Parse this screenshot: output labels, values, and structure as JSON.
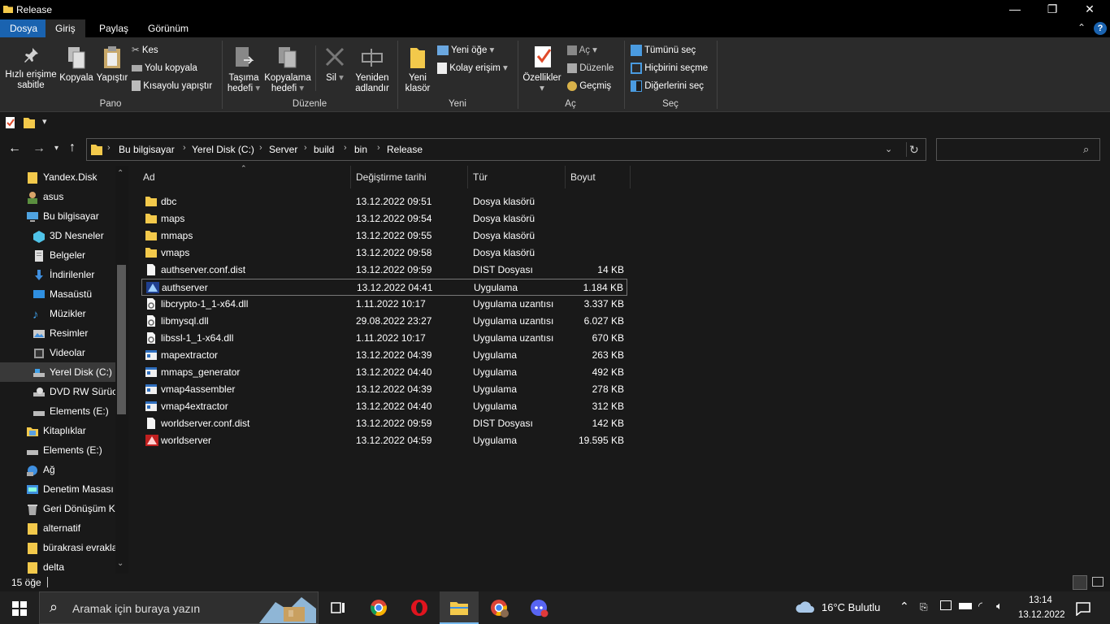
{
  "window": {
    "title": "Release",
    "min_glyph": "—",
    "max_glyph": "❐",
    "close_glyph": "✕"
  },
  "ribbon": {
    "tabs": [
      "Dosya",
      "Giriş",
      "Paylaş",
      "Görünüm"
    ],
    "pano": {
      "pin_label_1": "Hızlı erişime",
      "pin_label_2": "sabitle",
      "copy_label": "Kopyala",
      "paste_label": "Yapıştır",
      "cut_label": "Kes",
      "copypath_label": "Yolu kopyala",
      "pasteshortcut_label": "Kısayolu yapıştır",
      "group_label": "Pano"
    },
    "duzenle": {
      "move_label_1": "Taşıma",
      "move_label_2": "hedefi",
      "copyto_label_1": "Kopyalama",
      "copyto_label_2": "hedefi",
      "delete_label": "Sil",
      "rename_label_1": "Yeniden",
      "rename_label_2": "adlandır",
      "group_label": "Düzenle"
    },
    "yeni": {
      "newfolder_label_1": "Yeni",
      "newfolder_label_2": "klasör",
      "newitem_label": "Yeni öğe",
      "easyaccess_label": "Kolay erişim",
      "group_label": "Yeni"
    },
    "ac": {
      "properties_label": "Özellikler",
      "open_label": "Aç",
      "edit_label": "Düzenle",
      "history_label": "Geçmiş",
      "group_label": "Aç"
    },
    "sec": {
      "selectall_label": "Tümünü seç",
      "selectnone_label": "Hiçbirini seçme",
      "invert_label": "Diğerlerini seç",
      "group_label": "Seç"
    }
  },
  "address": {
    "crumbs": [
      "Bu bilgisayar",
      "Yerel Disk (C:)",
      "Server",
      "build",
      "bin",
      "Release"
    ]
  },
  "nav": {
    "items": [
      "Yandex.Disk",
      "asus",
      "Bu bilgisayar",
      "3D Nesneler",
      "Belgeler",
      "İndirilenler",
      "Masaüstü",
      "Müzikler",
      "Resimler",
      "Videolar",
      "Yerel Disk (C:)",
      "DVD RW Sürücü",
      "Elements (E:)",
      "Kitaplıklar",
      "Elements (E:)",
      "Ağ",
      "Denetim Masası",
      "Geri Dönüşüm K",
      "alternatif",
      "bürakrasi evrakla",
      "delta"
    ]
  },
  "columns": {
    "name": "Ad",
    "date": "Değiştirme tarihi",
    "type": "Tür",
    "size": "Boyut"
  },
  "files": [
    {
      "name": "dbc",
      "date": "13.12.2022 09:51",
      "type": "Dosya klasörü",
      "size": "",
      "icon": "folder-icon"
    },
    {
      "name": "maps",
      "date": "13.12.2022 09:54",
      "type": "Dosya klasörü",
      "size": "",
      "icon": "folder-icon"
    },
    {
      "name": "mmaps",
      "date": "13.12.2022 09:55",
      "type": "Dosya klasörü",
      "size": "",
      "icon": "folder-icon"
    },
    {
      "name": "vmaps",
      "date": "13.12.2022 09:58",
      "type": "Dosya klasörü",
      "size": "",
      "icon": "folder-icon"
    },
    {
      "name": "authserver.conf.dist",
      "date": "13.12.2022 09:59",
      "type": "DIST Dosyası",
      "size": "14 KB",
      "icon": "file-icon"
    },
    {
      "name": "authserver",
      "date": "13.12.2022 04:41",
      "type": "Uygulama",
      "size": "1.184 KB",
      "icon": "auth-exe-icon"
    },
    {
      "name": "libcrypto-1_1-x64.dll",
      "date": "1.11.2022 10:17",
      "type": "Uygulama uzantısı",
      "size": "3.337 KB",
      "icon": "dll-icon"
    },
    {
      "name": "libmysql.dll",
      "date": "29.08.2022 23:27",
      "type": "Uygulama uzantısı",
      "size": "6.027 KB",
      "icon": "dll-icon"
    },
    {
      "name": "libssl-1_1-x64.dll",
      "date": "1.11.2022 10:17",
      "type": "Uygulama uzantısı",
      "size": "670 KB",
      "icon": "dll-icon"
    },
    {
      "name": "mapextractor",
      "date": "13.12.2022 04:39",
      "type": "Uygulama",
      "size": "263 KB",
      "icon": "exe-icon"
    },
    {
      "name": "mmaps_generator",
      "date": "13.12.2022 04:40",
      "type": "Uygulama",
      "size": "492 KB",
      "icon": "exe-icon"
    },
    {
      "name": "vmap4assembler",
      "date": "13.12.2022 04:39",
      "type": "Uygulama",
      "size": "278 KB",
      "icon": "exe-icon"
    },
    {
      "name": "vmap4extractor",
      "date": "13.12.2022 04:40",
      "type": "Uygulama",
      "size": "312 KB",
      "icon": "exe-icon"
    },
    {
      "name": "worldserver.conf.dist",
      "date": "13.12.2022 09:59",
      "type": "DIST Dosyası",
      "size": "142 KB",
      "icon": "file-icon"
    },
    {
      "name": "worldserver",
      "date": "13.12.2022 04:59",
      "type": "Uygulama",
      "size": "19.595 KB",
      "icon": "world-exe-icon"
    }
  ],
  "status": {
    "count": "15 öğe"
  },
  "taskbar": {
    "search_placeholder": "Aramak için buraya yazın",
    "weather": "16°C  Bulutlu",
    "time": "13:14",
    "date": "13.12.2022"
  },
  "colors": {
    "accent": "#1a63b0",
    "folder": "#f3c94b",
    "selection_border": "#777777"
  }
}
